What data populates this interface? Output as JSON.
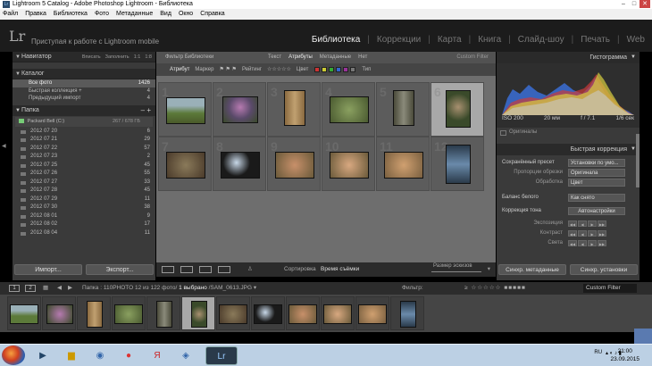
{
  "window": {
    "title": "Lightroom 5 Catalog - Adobe Photoshop Lightroom - Библиотека",
    "min": "–",
    "max": "□",
    "close": "✕"
  },
  "menu": [
    "Файл",
    "Правка",
    "Библиотека",
    "Фото",
    "Метаданные",
    "Вид",
    "Окно",
    "Справка"
  ],
  "identity": {
    "logo": "Lr",
    "text": "Приступая к работе с Lightroom mobile"
  },
  "modules": [
    {
      "label": "Библиотека",
      "active": true
    },
    {
      "label": "Коррекции"
    },
    {
      "label": "Карта"
    },
    {
      "label": "Книга"
    },
    {
      "label": "Слайд-шоу"
    },
    {
      "label": "Печать"
    },
    {
      "label": "Web"
    }
  ],
  "navigator": {
    "title": "Навигатор",
    "options": [
      "Вписать",
      "Заполнить",
      "1:1",
      "1:8"
    ]
  },
  "catalog": {
    "title": "Каталог",
    "items": [
      {
        "label": "Все фото",
        "count": "1426"
      },
      {
        "label": "Быстрая коллекция +",
        "count": "4"
      },
      {
        "label": "Предыдущий импорт",
        "count": "4"
      }
    ]
  },
  "folders": {
    "title": "Папка",
    "drive": "Packard Bell (C:)",
    "drive_info": "267 / 678 ГБ",
    "items": [
      {
        "label": "2012 07 20",
        "count": "6"
      },
      {
        "label": "2012 07 21",
        "count": "29"
      },
      {
        "label": "2012 07 22",
        "count": "57"
      },
      {
        "label": "2012 07 23",
        "count": "2"
      },
      {
        "label": "2012 07 25",
        "count": "45"
      },
      {
        "label": "2012 07 26",
        "count": "55"
      },
      {
        "label": "2012 07 27",
        "count": "33"
      },
      {
        "label": "2012 07 28",
        "count": "45"
      },
      {
        "label": "2012 07 29",
        "count": "11"
      },
      {
        "label": "2012 07 30",
        "count": "38"
      },
      {
        "label": "2012 08 01",
        "count": "9"
      },
      {
        "label": "2012 08 02",
        "count": "17"
      },
      {
        "label": "2012 08 04",
        "count": "11"
      }
    ]
  },
  "left_buttons": {
    "import": "Импорт...",
    "export": "Экспорт..."
  },
  "filter": {
    "title": "Фильтр Библиотеки",
    "tabs": [
      "Текст",
      "Атрибуты",
      "Метаданные",
      "Нет"
    ],
    "custom": "Custom Filter",
    "row": [
      "Атрибут",
      "Маркер",
      "Рейтинг",
      "Цвет",
      "Тип"
    ]
  },
  "grid": {
    "numbers": [
      "1",
      "2",
      "3",
      "4",
      "5",
      "6",
      "7",
      "8",
      "9",
      "10",
      "11",
      "12"
    ]
  },
  "toolbar": {
    "sort_label": "Сортировка",
    "sort_value": "Время съёмки",
    "thumb_label": "Размер эскизов"
  },
  "histogram": {
    "title": "Гистограмма",
    "iso": "ISO 200",
    "focal": "20 мм",
    "aperture": "f / 7.1",
    "shutter": "1/6 сек",
    "originals": "Оригиналы"
  },
  "quick": {
    "title": "Быстрая коррекция",
    "preset_label": "Сохранённый пресет",
    "preset_value": "Установки по умо...",
    "crop_label": "Пропорции обрезки",
    "crop_value": "Оригинала",
    "treat_label": "Обработка",
    "treat_value": "Цвет",
    "wb_label": "Баланс белого",
    "wb_value": "Как снято",
    "tone_label": "Коррекция тона",
    "auto": "Автонастройки",
    "exposure": "Экспозиция",
    "contrast": "Контраст",
    "highlights": "Света"
  },
  "right_buttons": {
    "sync_meta": "Синхр. метаданные",
    "sync_settings": "Синхр. установки"
  },
  "filmstrip_bar": {
    "page1": "1",
    "page2": "2",
    "folder": "Папка : 110PHOTO",
    "count": "12 из 122 фото/",
    "selected": "1 выбрано",
    "file": "/SAM_0613.JPG",
    "filter_label": "Фильтр:",
    "custom": "Custom Filter"
  },
  "taskbar": {
    "lang": "RU",
    "time": "21:00",
    "date": "23.09.2015"
  }
}
